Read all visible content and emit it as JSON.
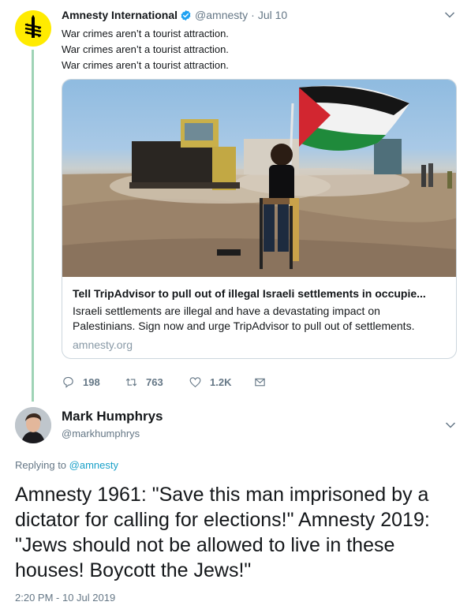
{
  "parent_tweet": {
    "author_name": "Amnesty International",
    "handle": "@amnesty",
    "separator": "·",
    "date": "Jul 10",
    "lines": [
      "War crimes aren’t a tourist attraction.",
      "War crimes aren’t a tourist attraction.",
      "War crimes aren’t a tourist attraction."
    ],
    "card": {
      "title": "Tell TripAdvisor to pull out of illegal Israeli settlements in occupie...",
      "description": "Israeli settlements are illegal and have a devastating impact on Palestinians. Sign now and urge TripAdvisor to pull out of settlements.",
      "domain": "amnesty.org"
    },
    "actions": {
      "replies": "198",
      "retweets": "763",
      "likes": "1.2K"
    }
  },
  "reply_tweet": {
    "author_name": "Mark Humphrys",
    "handle": "@markhumphrys",
    "replying_prefix": "Replying to",
    "replying_to": "@amnesty",
    "text": "Amnesty 1961: \"Save this man imprisoned by a dictator for calling for elections!\" Amnesty 2019: \"Jews should not be allowed to live in these houses! Boycott the Jews!\"",
    "timestamp": "2:20 PM - 10 Jul 2019"
  },
  "colors": {
    "accent": "#1da1f2",
    "amnesty_yellow": "#ffeb00",
    "thread_line": "#9fd3b6",
    "muted_text": "#657786"
  },
  "icons": {
    "amnesty_logo": "candle-barbed-wire-icon",
    "verified": "verified-badge-icon",
    "more": "chevron-down-icon",
    "reply": "reply-icon",
    "retweet": "retweet-icon",
    "like": "heart-icon",
    "message": "envelope-icon"
  }
}
